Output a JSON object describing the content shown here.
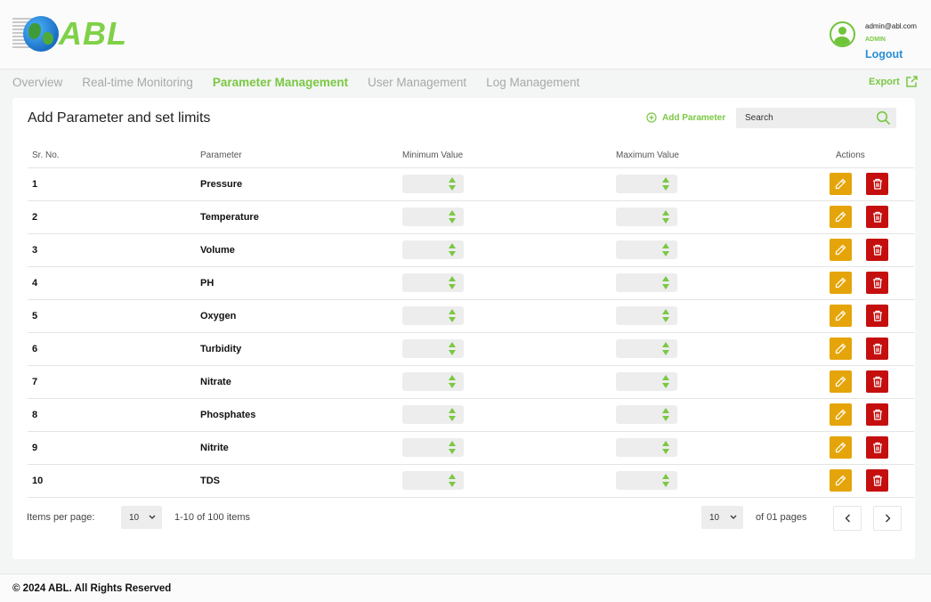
{
  "brand": {
    "name": "ABL",
    "accent": "#7ac843"
  },
  "user": {
    "email": "admin@abl.com",
    "role": "ADMIN",
    "logout_label": "Logout"
  },
  "nav": {
    "tabs": [
      {
        "label": "Overview",
        "active": false
      },
      {
        "label": "Real-time Monitoring",
        "active": false
      },
      {
        "label": "Parameter Management",
        "active": true
      },
      {
        "label": "User Management",
        "active": false
      },
      {
        "label": "Log Management",
        "active": false
      }
    ],
    "export_label": "Export"
  },
  "panel": {
    "title": "Add Parameter and set limits",
    "add_label": "Add Parameter",
    "search_placeholder": "Search"
  },
  "table": {
    "headers": [
      "Sr. No.",
      "Parameter",
      "Minimum Value",
      "Maximum Value",
      "Actions"
    ],
    "rows": [
      {
        "sr": "1",
        "param": "Pressure"
      },
      {
        "sr": "2",
        "param": "Temperature"
      },
      {
        "sr": "3",
        "param": "Volume"
      },
      {
        "sr": "4",
        "param": "PH"
      },
      {
        "sr": "5",
        "param": "Oxygen"
      },
      {
        "sr": "6",
        "param": "Turbidity"
      },
      {
        "sr": "7",
        "param": "Nitrate"
      },
      {
        "sr": "8",
        "param": "Phosphates"
      },
      {
        "sr": "9",
        "param": "Nitrite"
      },
      {
        "sr": "10",
        "param": "TDS"
      }
    ]
  },
  "pagination": {
    "items_per_page_label": "Items per page:",
    "items_per_page": "10",
    "range": "1-10 of 100 items",
    "page_select": "10",
    "pages_label": "of 01 pages"
  },
  "footer": {
    "copyright": "© 2024 ABL. All Rights Reserved"
  },
  "colors": {
    "edit": "#e5a50a",
    "delete": "#c50f0f",
    "accent": "#7ac843",
    "link": "#2b8fd6"
  }
}
